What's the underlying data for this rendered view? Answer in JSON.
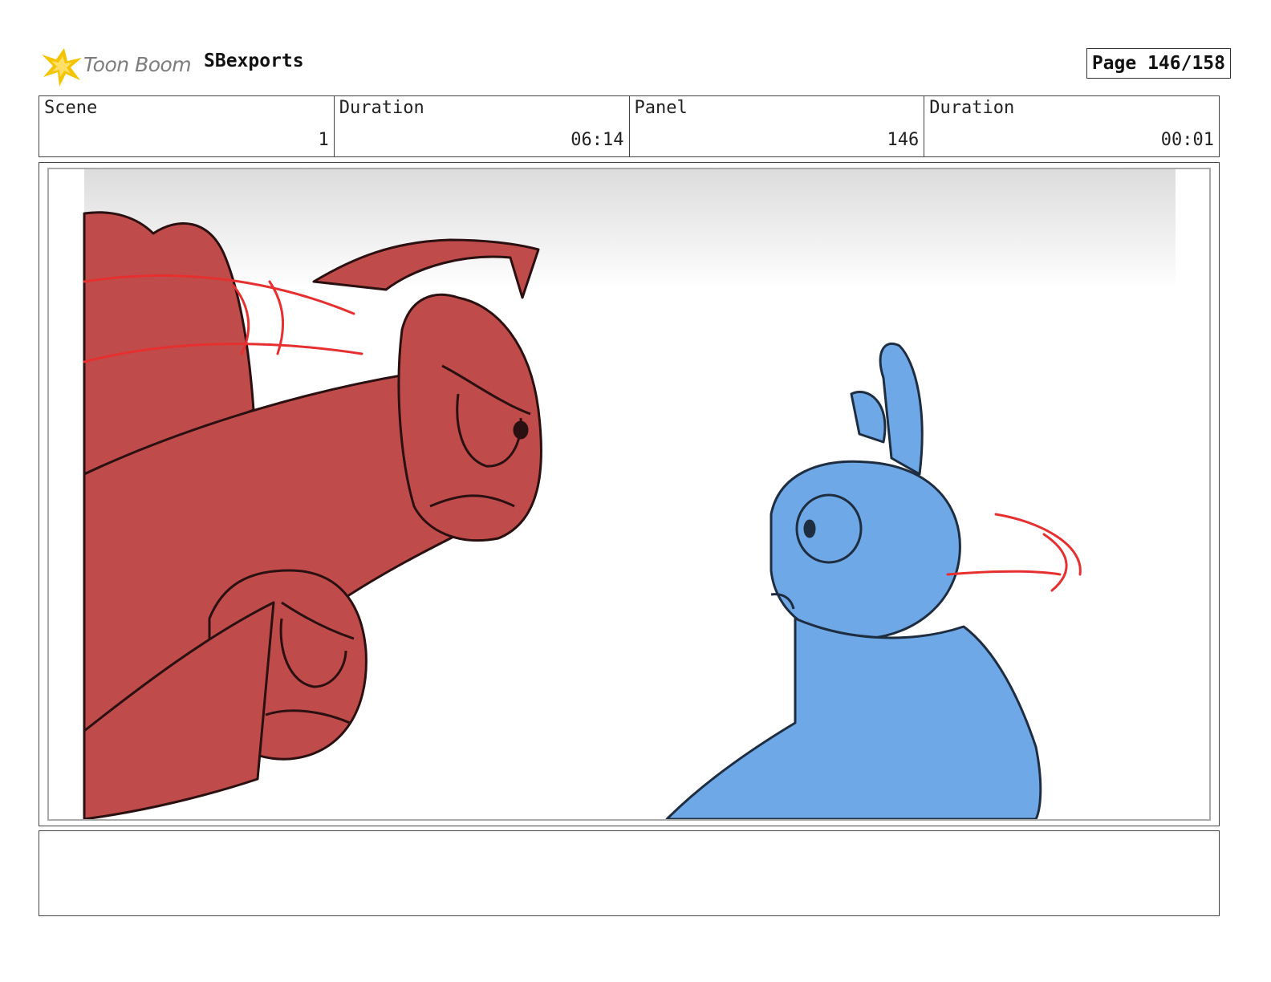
{
  "header": {
    "logo_text": "Toon Boom",
    "project_name": "SBexports",
    "page_label": "Page 146/158"
  },
  "info": {
    "scene_label": "Scene",
    "scene_value": "1",
    "scene_duration_label": "Duration",
    "scene_duration_value": "06:14",
    "panel_label": "Panel",
    "panel_value": "146",
    "panel_duration_label": "Duration",
    "panel_duration_value": "00:01"
  },
  "colors": {
    "red_character": "#c04b4b",
    "blue_character": "#6fa8e6",
    "outline": "#2a1010",
    "motion_lines": "#e63030",
    "logo_star": "#f5c400"
  },
  "icons": {
    "logo": "toon-boom-star-icon"
  }
}
